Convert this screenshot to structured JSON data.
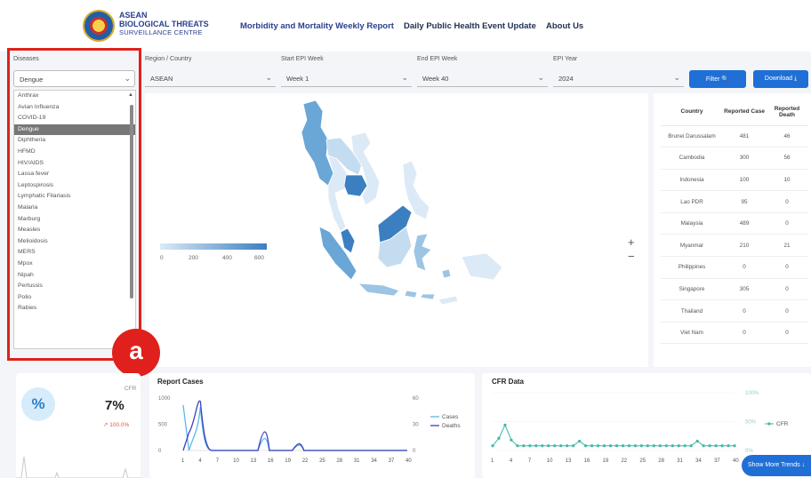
{
  "header": {
    "brand_line1": "ASEAN",
    "brand_line2": "BIOLOGICAL THREATS",
    "brand_line3": "SURVEILLANCE CENTRE",
    "nav": [
      "Morbidity and Mortality Weekly Report",
      "Daily Public Health Event Update",
      "About Us"
    ]
  },
  "filters": {
    "diseases_label": "Diseases",
    "diseases_value": "Dengue",
    "region_label": "Region / Country",
    "region_value": "ASEAN",
    "start_label": "Start EPI Week",
    "start_value": "Week 1",
    "end_label": "End EPI Week",
    "end_value": "Week 40",
    "year_label": "EPI Year",
    "year_value": "2024",
    "filter_button": "Filter 🔍",
    "download_button": "Download ⤓"
  },
  "disease_options": [
    "Anthrax",
    "Avian Influenza",
    "COVID-19",
    "Dengue",
    "Diphtheria",
    "HFMD",
    "HIV/AIDS",
    "Lassa fever",
    "Leptospirosis",
    "Lymphatic Filariasis",
    "Malaria",
    "Marburg",
    "Measles",
    "Melioidosis",
    "MERS",
    "Mpox",
    "Nipah",
    "Pertussis",
    "Polio",
    "Rabies"
  ],
  "selected_index": 3,
  "annotation_label": "a",
  "map": {
    "legend_ticks": [
      "0",
      "200",
      "400",
      "600"
    ],
    "zoom_in": "+",
    "zoom_out": "−",
    "colors": [
      "#dbeaf6",
      "#c4dcef",
      "#9cc4e4",
      "#6aa6d6",
      "#3b7fc0"
    ]
  },
  "table": {
    "headers": [
      "Country",
      "Reported Case",
      "Reported Death"
    ],
    "rows": [
      [
        "Brunei Darussalam",
        "481",
        "46"
      ],
      [
        "Cambodia",
        "300",
        "56"
      ],
      [
        "Indonesia",
        "100",
        "10"
      ],
      [
        "Lao PDR",
        "95",
        "0"
      ],
      [
        "Malaysia",
        "489",
        "0"
      ],
      [
        "Myanmar",
        "210",
        "21"
      ],
      [
        "Philippines",
        "0",
        "0"
      ],
      [
        "Singapore",
        "305",
        "0"
      ],
      [
        "Thailand",
        "0",
        "0"
      ],
      [
        "Viet Nam",
        "0",
        "0"
      ]
    ]
  },
  "cfr_card": {
    "label": "CFR",
    "value": "7%",
    "change": "↗ 100.0%",
    "icon": "percent-icon"
  },
  "report_cases": {
    "title": "Report Cases",
    "legend": [
      "Cases",
      "Deaths"
    ],
    "y_left": [
      "1000",
      "500",
      "0"
    ],
    "y_right": [
      "60",
      "30",
      "0"
    ],
    "x_ticks": [
      "1",
      "4",
      "7",
      "10",
      "13",
      "16",
      "19",
      "22",
      "25",
      "28",
      "31",
      "34",
      "37",
      "40"
    ],
    "colors": {
      "cases": "#5bb8e8",
      "deaths": "#3a3fbf"
    }
  },
  "cfr_data": {
    "title": "CFR Data",
    "y_right": [
      "100%",
      "50%",
      "0%"
    ],
    "legend": [
      "CFR"
    ],
    "x_ticks": [
      "1",
      "4",
      "7",
      "10",
      "13",
      "16",
      "19",
      "22",
      "25",
      "28",
      "31",
      "34",
      "37",
      "40"
    ],
    "color": "#3fb7a6"
  },
  "show_more": "Show More Trends ↓"
}
